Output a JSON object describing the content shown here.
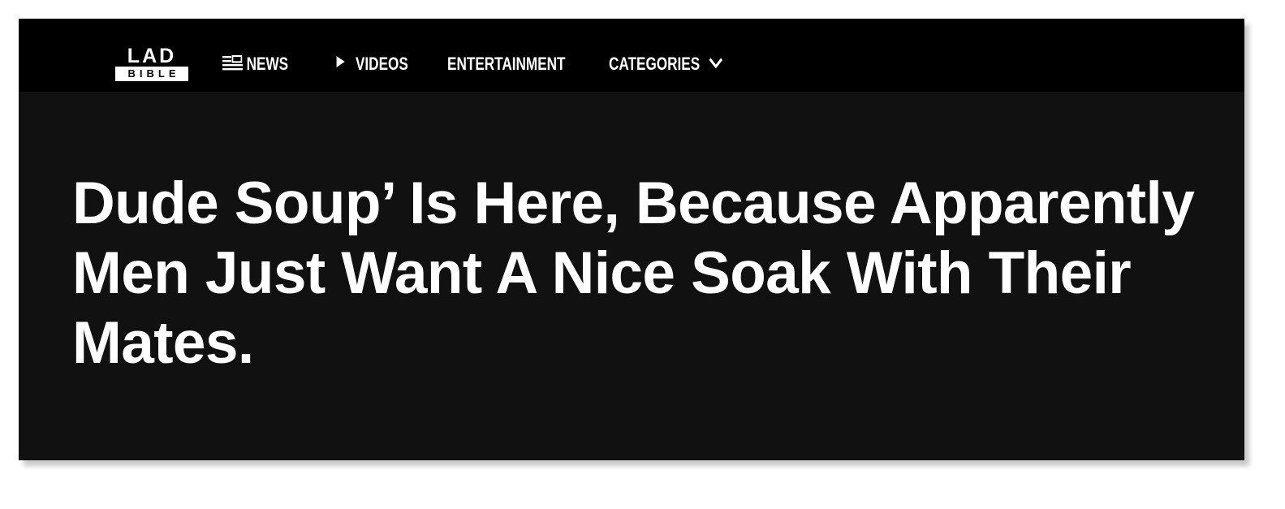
{
  "brand": {
    "logo_top": "LAD",
    "logo_bottom": "BIBLE"
  },
  "nav": {
    "news": {
      "label": "NEWS",
      "icon": "newspaper-icon"
    },
    "videos": {
      "label": "VIDEOS",
      "icon": "play-icon"
    },
    "entertainment": {
      "label": "ENTERTAINMENT"
    },
    "categories": {
      "label": "CATEGORIES",
      "icon": "chevron-down-icon"
    }
  },
  "article": {
    "headline": "Dude Soup’ Is Here, Because Apparently Men Just Want A Nice Soak With Their Mates."
  },
  "colors": {
    "navbar_bg": "#000000",
    "hero_bg": "#111111",
    "text": "#ffffff"
  }
}
